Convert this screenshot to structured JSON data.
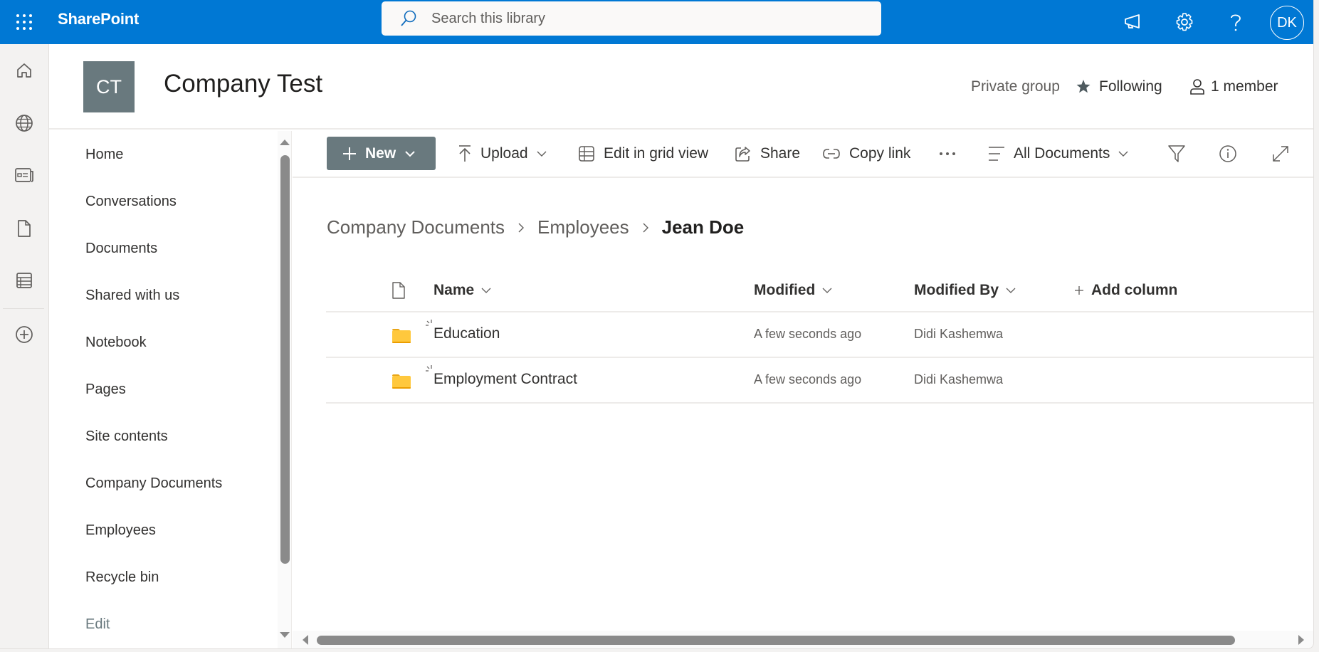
{
  "suitebar": {
    "app_name": "SharePoint",
    "search_placeholder": "Search this library",
    "avatar_initials": "DK",
    "brand_color": "#0078d4",
    "icons": [
      "app-launcher-icon",
      "megaphone-icon",
      "gear-icon",
      "help-icon"
    ]
  },
  "appbar": {
    "items": [
      {
        "icon": "home-icon",
        "label": "Home"
      },
      {
        "icon": "globe-icon",
        "label": "My sites"
      },
      {
        "icon": "news-icon",
        "label": "My news"
      },
      {
        "icon": "file-icon",
        "label": "My files"
      },
      {
        "icon": "list-icon",
        "label": "My lists"
      },
      {
        "icon": "add-icon",
        "label": "Create"
      }
    ]
  },
  "site": {
    "logo_initials": "CT",
    "logo_color": "#69797e",
    "title": "Company Test",
    "privacy": "Private group",
    "following_label": "Following",
    "members_label": "1 member"
  },
  "leftnav": {
    "items": [
      "Home",
      "Conversations",
      "Documents",
      "Shared with us",
      "Notebook",
      "Pages",
      "Site contents",
      "Company Documents",
      "Employees",
      "Recycle bin"
    ],
    "edit_label": "Edit"
  },
  "commandbar": {
    "new_label": "New",
    "upload_label": "Upload",
    "grid_label": "Edit in grid view",
    "share_label": "Share",
    "copylink_label": "Copy link",
    "more_label": "...",
    "view_label": "All Documents"
  },
  "breadcrumb": {
    "items": [
      "Company Documents",
      "Employees"
    ],
    "current": "Jean Doe"
  },
  "list": {
    "columns": {
      "name": "Name",
      "modified": "Modified",
      "modified_by": "Modified By",
      "add_column": "Add column"
    },
    "rows": [
      {
        "type": "folder",
        "name": "Education",
        "modified": "A few seconds ago",
        "modified_by": "Didi Kashemwa",
        "is_new": true
      },
      {
        "type": "folder",
        "name": "Employment Contract",
        "modified": "A few seconds ago",
        "modified_by": "Didi Kashemwa",
        "is_new": true
      }
    ]
  }
}
